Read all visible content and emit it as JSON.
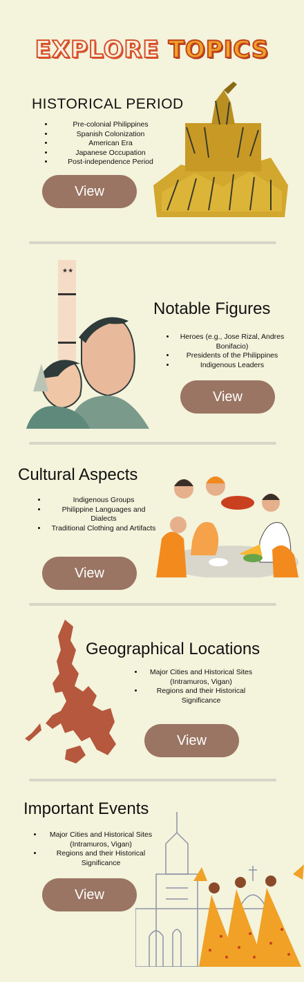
{
  "header": {
    "title_part1": "EXPLORE",
    "title_part2": "TOPICS"
  },
  "sections": [
    {
      "heading": "HISTORICAL PERIOD",
      "items": [
        "Pre-colonial Philippines",
        "Spanish Colonization",
        "American Era",
        "Japanese Occupation",
        "Post-independence Period"
      ],
      "button_label": "View"
    },
    {
      "heading": "Notable Figures",
      "items": [
        "Heroes (e.g., Jose Rizal, Andres Bonifacio)",
        "Presidents of the Philippines",
        "Indigenous Leaders"
      ],
      "button_label": "View"
    },
    {
      "heading": "Cultural Aspects",
      "items": [
        "Indigenous Groups",
        "Philippine Languages and Dialects",
        "Traditional Clothing and Artifacts"
      ],
      "button_label": "View"
    },
    {
      "heading": "Geographical Locations",
      "items": [
        "Major Cities and Historical Sites (Intramuros, Vigan)",
        "Regions and their Historical Significance"
      ],
      "button_label": "View"
    },
    {
      "heading": "Important Events",
      "items": [
        "Major Cities and Historical Sites (Intramuros, Vigan)",
        "Regions and their Historical Significance"
      ],
      "button_label": "View"
    }
  ],
  "colors": {
    "background": "#f4f3dc",
    "button": "#9a7563",
    "accent_orange": "#f0a126",
    "accent_red": "#d7502b",
    "map": "#b5583d",
    "divider": "#d6d5c8"
  },
  "illustrations": [
    "historical-monument-illustration",
    "rizal-portrait-illustration",
    "family-feast-illustration",
    "philippines-map-illustration",
    "church-dancers-illustration"
  ]
}
